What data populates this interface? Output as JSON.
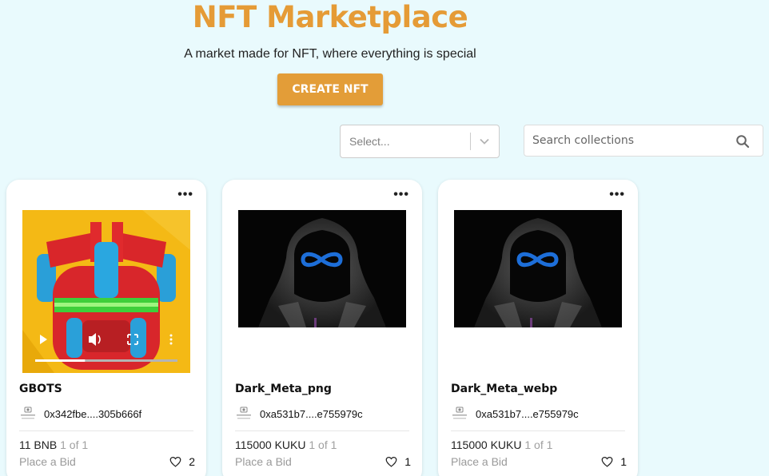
{
  "header": {
    "title": "NFT Marketplace",
    "subtitle": "A market made for NFT, where everything is special",
    "create_label": "CREATE NFT"
  },
  "filter": {
    "select_placeholder": "Select...",
    "search_placeholder": "Search collections"
  },
  "colors": {
    "background": "#e9fafd",
    "accent": "#e39d38"
  },
  "cards": [
    {
      "name": "GBOTS",
      "owner": "0x342fbe....305b666f",
      "price": "11 BNB",
      "edition": "1 of 1",
      "bid_label": "Place a Bid",
      "likes": "2",
      "media_type": "video",
      "video_progress": 0.35
    },
    {
      "name": "Dark_Meta_png",
      "owner": "0xa531b7....e755979c",
      "price": "115000 KUKU",
      "edition": "1 of 1",
      "bid_label": "Place a Bid",
      "likes": "1",
      "media_type": "image"
    },
    {
      "name": "Dark_Meta_webp",
      "owner": "0xa531b7....e755979c",
      "price": "115000 KUKU",
      "edition": "1 of 1",
      "bid_label": "Place a Bid",
      "likes": "1",
      "media_type": "image"
    }
  ]
}
